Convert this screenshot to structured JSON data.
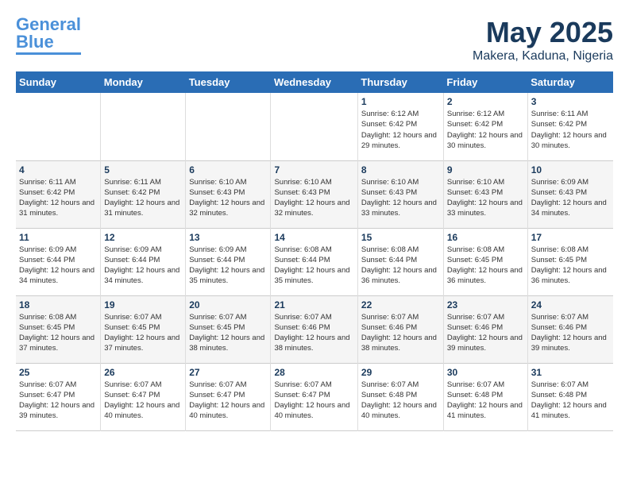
{
  "header": {
    "logo_general": "General",
    "logo_blue": "Blue",
    "month_title": "May 2025",
    "location": "Makera, Kaduna, Nigeria"
  },
  "weekdays": [
    "Sunday",
    "Monday",
    "Tuesday",
    "Wednesday",
    "Thursday",
    "Friday",
    "Saturday"
  ],
  "weeks": [
    [
      {
        "day": "",
        "info": ""
      },
      {
        "day": "",
        "info": ""
      },
      {
        "day": "",
        "info": ""
      },
      {
        "day": "",
        "info": ""
      },
      {
        "day": "1",
        "info": "Sunrise: 6:12 AM\nSunset: 6:42 PM\nDaylight: 12 hours and 29 minutes."
      },
      {
        "day": "2",
        "info": "Sunrise: 6:12 AM\nSunset: 6:42 PM\nDaylight: 12 hours and 30 minutes."
      },
      {
        "day": "3",
        "info": "Sunrise: 6:11 AM\nSunset: 6:42 PM\nDaylight: 12 hours and 30 minutes."
      }
    ],
    [
      {
        "day": "4",
        "info": "Sunrise: 6:11 AM\nSunset: 6:42 PM\nDaylight: 12 hours and 31 minutes."
      },
      {
        "day": "5",
        "info": "Sunrise: 6:11 AM\nSunset: 6:42 PM\nDaylight: 12 hours and 31 minutes."
      },
      {
        "day": "6",
        "info": "Sunrise: 6:10 AM\nSunset: 6:43 PM\nDaylight: 12 hours and 32 minutes."
      },
      {
        "day": "7",
        "info": "Sunrise: 6:10 AM\nSunset: 6:43 PM\nDaylight: 12 hours and 32 minutes."
      },
      {
        "day": "8",
        "info": "Sunrise: 6:10 AM\nSunset: 6:43 PM\nDaylight: 12 hours and 33 minutes."
      },
      {
        "day": "9",
        "info": "Sunrise: 6:10 AM\nSunset: 6:43 PM\nDaylight: 12 hours and 33 minutes."
      },
      {
        "day": "10",
        "info": "Sunrise: 6:09 AM\nSunset: 6:43 PM\nDaylight: 12 hours and 34 minutes."
      }
    ],
    [
      {
        "day": "11",
        "info": "Sunrise: 6:09 AM\nSunset: 6:44 PM\nDaylight: 12 hours and 34 minutes."
      },
      {
        "day": "12",
        "info": "Sunrise: 6:09 AM\nSunset: 6:44 PM\nDaylight: 12 hours and 34 minutes."
      },
      {
        "day": "13",
        "info": "Sunrise: 6:09 AM\nSunset: 6:44 PM\nDaylight: 12 hours and 35 minutes."
      },
      {
        "day": "14",
        "info": "Sunrise: 6:08 AM\nSunset: 6:44 PM\nDaylight: 12 hours and 35 minutes."
      },
      {
        "day": "15",
        "info": "Sunrise: 6:08 AM\nSunset: 6:44 PM\nDaylight: 12 hours and 36 minutes."
      },
      {
        "day": "16",
        "info": "Sunrise: 6:08 AM\nSunset: 6:45 PM\nDaylight: 12 hours and 36 minutes."
      },
      {
        "day": "17",
        "info": "Sunrise: 6:08 AM\nSunset: 6:45 PM\nDaylight: 12 hours and 36 minutes."
      }
    ],
    [
      {
        "day": "18",
        "info": "Sunrise: 6:08 AM\nSunset: 6:45 PM\nDaylight: 12 hours and 37 minutes."
      },
      {
        "day": "19",
        "info": "Sunrise: 6:07 AM\nSunset: 6:45 PM\nDaylight: 12 hours and 37 minutes."
      },
      {
        "day": "20",
        "info": "Sunrise: 6:07 AM\nSunset: 6:45 PM\nDaylight: 12 hours and 38 minutes."
      },
      {
        "day": "21",
        "info": "Sunrise: 6:07 AM\nSunset: 6:46 PM\nDaylight: 12 hours and 38 minutes."
      },
      {
        "day": "22",
        "info": "Sunrise: 6:07 AM\nSunset: 6:46 PM\nDaylight: 12 hours and 38 minutes."
      },
      {
        "day": "23",
        "info": "Sunrise: 6:07 AM\nSunset: 6:46 PM\nDaylight: 12 hours and 39 minutes."
      },
      {
        "day": "24",
        "info": "Sunrise: 6:07 AM\nSunset: 6:46 PM\nDaylight: 12 hours and 39 minutes."
      }
    ],
    [
      {
        "day": "25",
        "info": "Sunrise: 6:07 AM\nSunset: 6:47 PM\nDaylight: 12 hours and 39 minutes."
      },
      {
        "day": "26",
        "info": "Sunrise: 6:07 AM\nSunset: 6:47 PM\nDaylight: 12 hours and 40 minutes."
      },
      {
        "day": "27",
        "info": "Sunrise: 6:07 AM\nSunset: 6:47 PM\nDaylight: 12 hours and 40 minutes."
      },
      {
        "day": "28",
        "info": "Sunrise: 6:07 AM\nSunset: 6:47 PM\nDaylight: 12 hours and 40 minutes."
      },
      {
        "day": "29",
        "info": "Sunrise: 6:07 AM\nSunset: 6:48 PM\nDaylight: 12 hours and 40 minutes."
      },
      {
        "day": "30",
        "info": "Sunrise: 6:07 AM\nSunset: 6:48 PM\nDaylight: 12 hours and 41 minutes."
      },
      {
        "day": "31",
        "info": "Sunrise: 6:07 AM\nSunset: 6:48 PM\nDaylight: 12 hours and 41 minutes."
      }
    ]
  ]
}
